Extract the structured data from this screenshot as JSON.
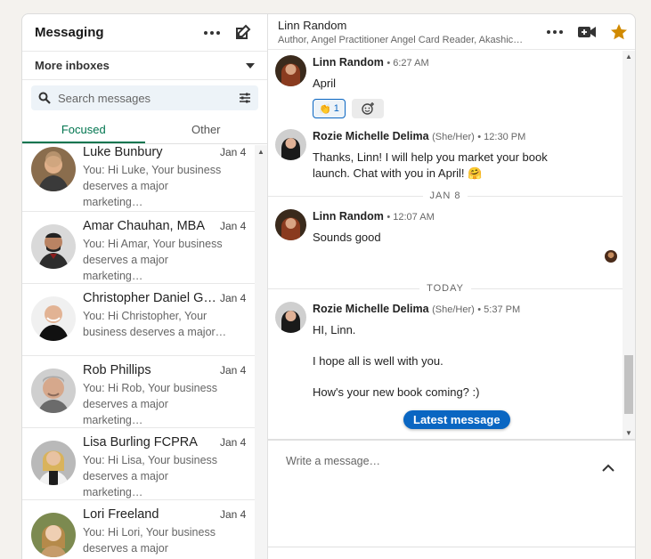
{
  "sidebar": {
    "title": "Messaging",
    "inbox_label": "More inboxes",
    "search_placeholder": "Search messages",
    "tabs": [
      "Focused",
      "Other"
    ],
    "conversations": [
      {
        "name": "Luke Bunbury",
        "date": "Jan 4",
        "preview": "You: Hi Luke, Your business deserves a major marketing…"
      },
      {
        "name": "Amar Chauhan, MBA",
        "date": "Jan 4",
        "preview": "You: Hi Amar, Your business deserves a major marketing…"
      },
      {
        "name": "Christopher Daniel Go…",
        "date": "Jan 4",
        "preview": "You: Hi Christopher, Your business deserves a major…"
      },
      {
        "name": "Rob Phillips",
        "date": "Jan 4",
        "preview": "You: Hi Rob, Your business deserves a major marketing…"
      },
      {
        "name": "Lisa Burling FCPRA",
        "date": "Jan 4",
        "preview": "You: Hi Lisa, Your business deserves a major marketing…"
      },
      {
        "name": "Lori Freeland",
        "date": "Jan 4",
        "preview": "You: Hi Lori, Your business deserves a major marketing…"
      }
    ]
  },
  "thread": {
    "name": "Linn Random",
    "headline": "Author, Angel Practitioner Angel Card Reader, Akashic Reco",
    "messages": [
      {
        "sender": "Linn Random",
        "pronouns": "",
        "time": "• 6:27 AM",
        "text": "April",
        "reaction": "👏",
        "reaction_count": "1"
      },
      {
        "sender": "Rozie Michelle Delima",
        "pronouns": "(She/Her)",
        "time": "• 12:30 PM",
        "text": "Thanks, Linn! I will help you market your book launch. Chat with you in April! 🤗"
      },
      {
        "sender": "Linn Random",
        "pronouns": "",
        "time": "• 12:07 AM",
        "text": "Sounds good"
      },
      {
        "sender": "Rozie Michelle Delima",
        "pronouns": "(She/Her)",
        "time": "• 5:37 PM",
        "lines": [
          "HI, Linn.",
          "I hope all is well with you.",
          "How's your new book coming? :)"
        ]
      }
    ],
    "dividers": [
      "JAN 8",
      "TODAY"
    ],
    "latest_label": "Latest message",
    "compose_placeholder": "Write a message…"
  },
  "colors": {
    "accent": "#0a66c2",
    "focused_green": "#01754f",
    "star": "#d18a00"
  }
}
